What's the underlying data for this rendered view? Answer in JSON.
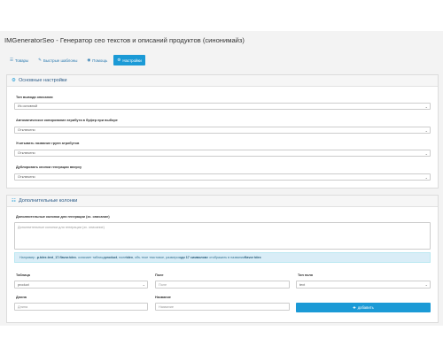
{
  "header": {
    "title": "IMGeneratorSeo - Генератор сео текстов и описаний продуктов (синонимайз)"
  },
  "tabs": [
    {
      "label": "Товары",
      "icon": "list-icon"
    },
    {
      "label": "Быстрые шаблоны",
      "icon": "magic-wand-icon"
    },
    {
      "label": "Помощь",
      "icon": "eye-icon"
    },
    {
      "label": "Настройки",
      "icon": "gear-icon",
      "active": true
    }
  ],
  "main_settings": {
    "title": "Основные настройки",
    "fields": [
      {
        "label": "Тип вывода описания",
        "value": "Из основной"
      },
      {
        "label": "Автоматическое копирование атрибута в буфер при выборе",
        "value": "Отключено"
      },
      {
        "label": "Учитывать название групп атрибутов",
        "value": "Отключено"
      },
      {
        "label": "Дублировать кнопки генерации вверху",
        "value": "Отключено"
      }
    ]
  },
  "extra_columns": {
    "title": "Дополнительные колонки",
    "textarea_label": "Дополнительные колонки для генерации (зх. описание)",
    "textarea_placeholder": "Дополнительные колонки для генерации (зх. описание)",
    "hint_prefix": "Например - ",
    "hint_code": "p.tdex.text_17.flavor.tdex",
    "hint_mid": " - означает таблица ",
    "hint_table": "product",
    "hint_mid2": ", поле ",
    "hint_field": "tdex",
    "hint_mid3": ", объ.тное текстовое",
    "hint_mid4": ", размером ",
    "hint_size": "до 17 символов",
    "hint_mid5": " и отображать в названии ",
    "hint_name": "flavor tdex",
    "table_label": "Таблица",
    "table_value": "product",
    "field_label": "Поле",
    "field_placeholder": "Поле",
    "type_label": "Тип поля",
    "type_value": "text",
    "length_label": "Длина",
    "length_placeholder": "Длина",
    "name_label": "Название",
    "name_placeholder": "Название",
    "add_button": "добавить"
  },
  "colors": {
    "accent": "#1b9ad6",
    "hint_bg": "#d9edf7"
  }
}
